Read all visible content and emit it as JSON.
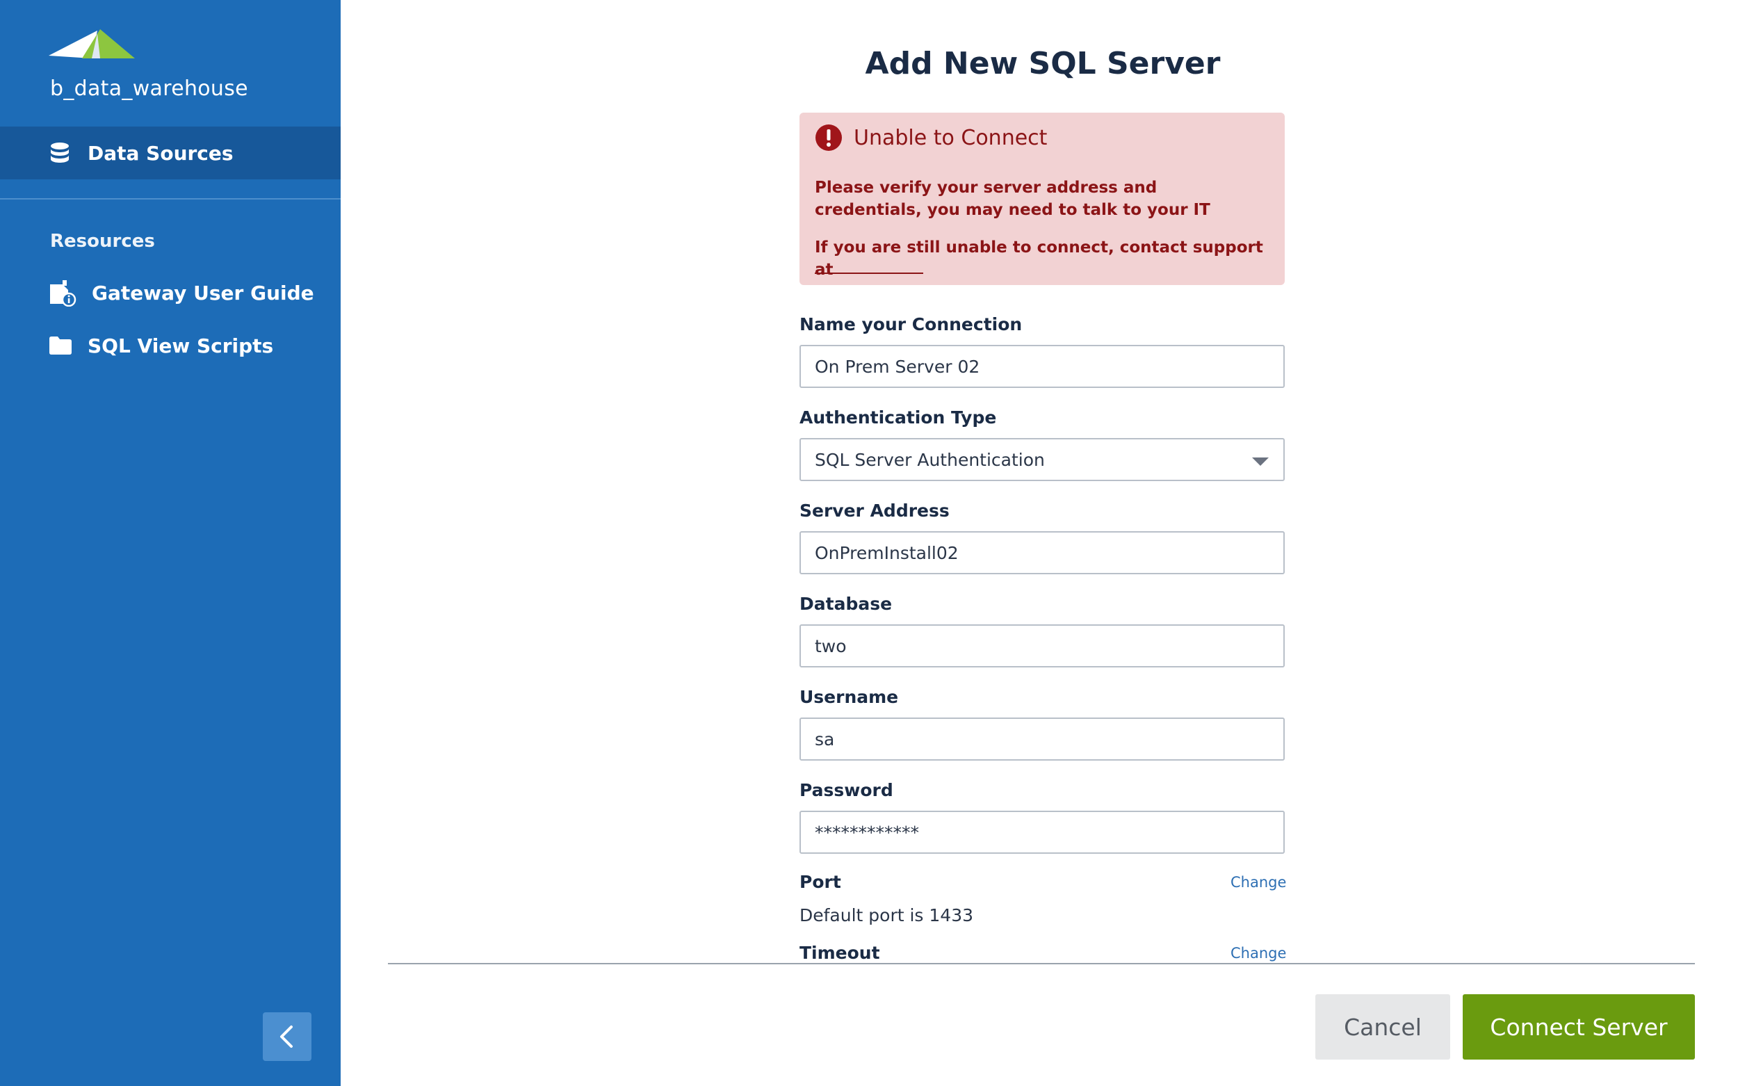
{
  "sidebar": {
    "brand": "b_data_warehouse",
    "active_item": "Data Sources",
    "section_title": "Resources",
    "resources": [
      {
        "label": "Gateway User Guide",
        "icon": "document-info-icon"
      },
      {
        "label": "SQL View Scripts",
        "icon": "folder-icon"
      }
    ]
  },
  "page": {
    "title": "Add New SQL Server"
  },
  "alert": {
    "title": "Unable to Connect",
    "message": "Please verify your server address and credentials, you may need to talk to your IT",
    "support": "If you are still unable to connect, contact support at"
  },
  "form": {
    "connection_name": {
      "label": "Name your Connection",
      "value": "On Prem Server 02"
    },
    "auth_type": {
      "label": "Authentication Type",
      "value": "SQL Server Authentication"
    },
    "server_address": {
      "label": "Server Address",
      "value": "OnPremInstall02"
    },
    "database": {
      "label": "Database",
      "value": "two"
    },
    "username": {
      "label": "Username",
      "value": "sa"
    },
    "password": {
      "label": "Password",
      "value": "************"
    },
    "port": {
      "label": "Port",
      "change": "Change",
      "description": "Default port is 1433"
    },
    "timeout": {
      "label": "Timeout",
      "change": "Change"
    }
  },
  "footer": {
    "cancel": "Cancel",
    "connect": "Connect Server"
  },
  "colors": {
    "sidebar": "#1d6cb7",
    "sidebar_active": "#17589a",
    "alert_bg": "#f2d2d3",
    "alert_text": "#8b1416",
    "primary_button": "#6a9b0f",
    "link": "#2d6fb3"
  }
}
